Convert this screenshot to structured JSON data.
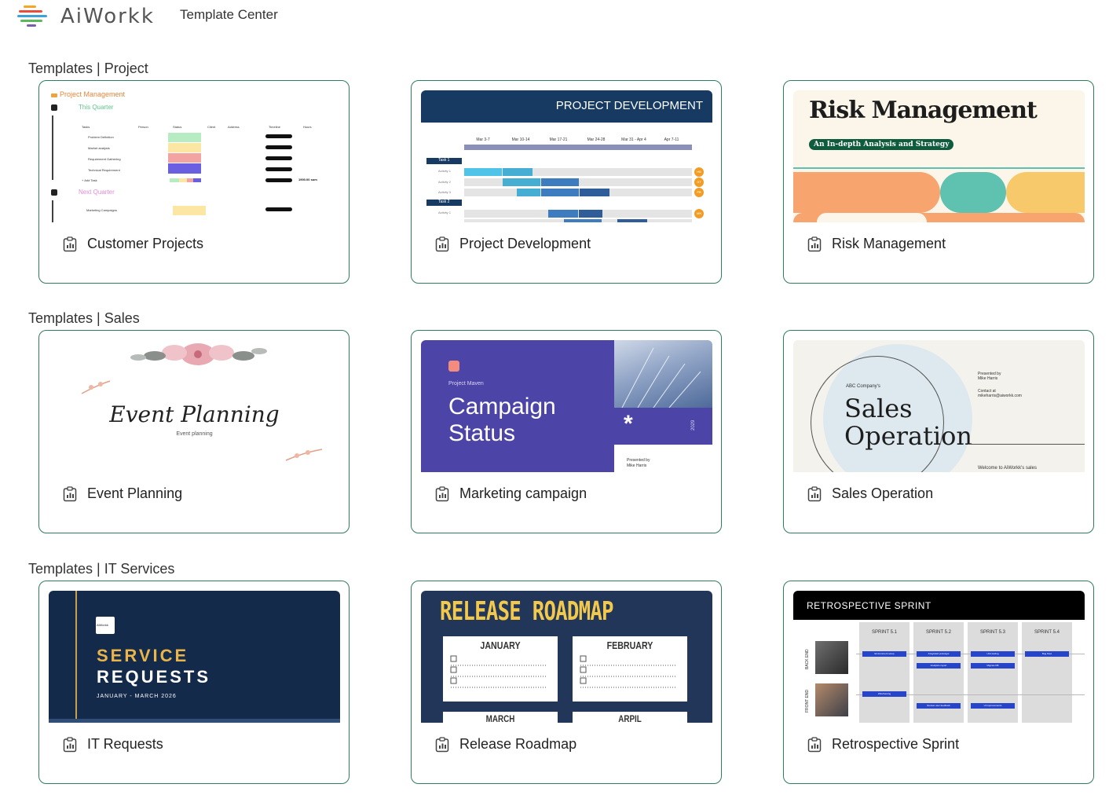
{
  "header": {
    "brand": "AiWorkk",
    "title": "Template Center"
  },
  "sections": [
    {
      "title": "Templates | Project",
      "cards": [
        {
          "label": "Customer Projects",
          "thumb": {
            "heading": "Project Management",
            "group1": "This Quarter",
            "group2": "Next Quarter",
            "cols": [
              "Tasks",
              "Person",
              "Status",
              "Client",
              "Address",
              "Timeline",
              "Hours"
            ],
            "rows": [
              "Problem Definition",
              "Market analysis",
              "Requirement Gathering",
              "Technical Requirement"
            ],
            "add": "+ Add Task",
            "total": "1900.00 sum",
            "row2": "Marketing Campaigns"
          }
        },
        {
          "label": "Project Development",
          "thumb": {
            "banner": "PROJECT DEVELOPMENT",
            "weeks": [
              "Mar 3-7",
              "Mar 10-14",
              "Mar 17-21",
              "Mar 24-28",
              "Mar 31 - Apr 4",
              "Apr 7-11"
            ],
            "task1": "Task 1",
            "task2": "Task 2",
            "acts": [
              "Activity 1",
              "Activity 2",
              "Activity 3",
              "Activity 1"
            ],
            "badges": [
              "HB",
              "GT",
              "PB",
              "MN"
            ]
          }
        },
        {
          "label": "Risk Management",
          "thumb": {
            "title": "Risk Management",
            "subtitle": "An In-depth Analysis and Strategy"
          }
        }
      ]
    },
    {
      "title": "Templates | Sales",
      "cards": [
        {
          "label": "Event Planning",
          "thumb": {
            "title": "Event Planning",
            "subtitle": "Event planning"
          }
        },
        {
          "label": "Marketing campaign",
          "thumb": {
            "kicker": "Project Maven",
            "title1": "Campaign",
            "title2": "Status",
            "presented": "Presented by",
            "name": "Mike Harris",
            "year": "2029"
          }
        },
        {
          "label": "Sales Operation",
          "thumb": {
            "company": "ABC Company's",
            "title1": "Sales",
            "title2": "Operation",
            "presented": "Presented by",
            "name": "Mike Harris",
            "contact": "Contact at",
            "email": "mikeharris@aiworkk.com",
            "welcome": "Welcome to AiWorkk's sales"
          }
        }
      ]
    },
    {
      "title": "Templates | IT Services",
      "cards": [
        {
          "label": "IT Requests",
          "thumb": {
            "logo": "AiWorkk",
            "title1": "SERVICE",
            "title2": "REQUESTS",
            "dates": "JANUARY - MARCH 2026"
          }
        },
        {
          "label": "Release Roadmap",
          "thumb": {
            "title": "RELEASE ROADMAP",
            "months": [
              "JANUARY",
              "FEBRUARY",
              "MARCH",
              "ARPIL"
            ]
          }
        },
        {
          "label": "Retrospective Sprint",
          "thumb": {
            "title": "RETROSPECTIVE SPRINT",
            "sprints": [
              "SPRINT 5.1",
              "SPRINT 5.2",
              "SPRINT 5.3",
              "SPRINT 5.4"
            ],
            "lanes": [
              "BACK END",
              "FRONT END"
            ],
            "tags": [
              "Environment setup",
              "Integrated prototype",
              "Unit testing",
              "Bug fixes",
              "Analytics report",
              "Migrate DB",
              "Wireframing",
              "Review user feedback",
              "UI improvements"
            ]
          }
        }
      ]
    }
  ],
  "colors": {
    "accent": "#2e7d5b",
    "navy": "#173a63",
    "purple": "#4d44a8",
    "orange": "#f7a46e",
    "teal": "#5fc1b0",
    "yellow": "#f8c96a",
    "gold": "#e9b54a"
  }
}
